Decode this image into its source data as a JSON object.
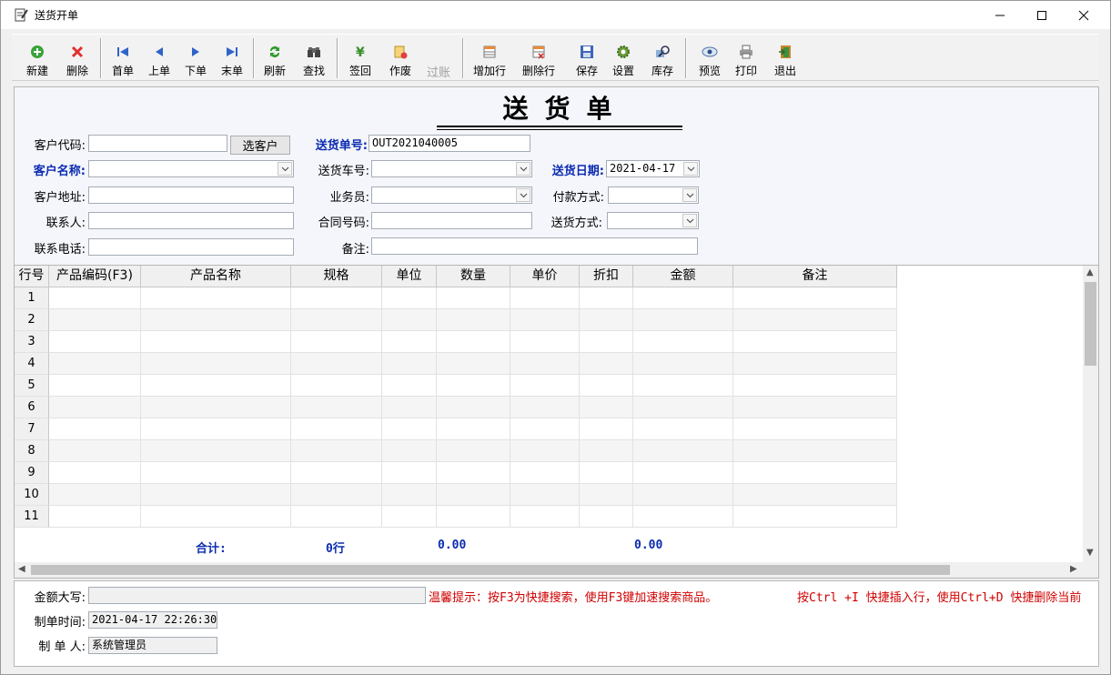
{
  "window": {
    "title": "送货开单"
  },
  "toolbar": {
    "new": "新建",
    "delete": "删除",
    "first": "首单",
    "prev": "上单",
    "next": "下单",
    "last": "末单",
    "refresh": "刷新",
    "find": "查找",
    "sign_back": "签回",
    "void": "作废",
    "post": "过账",
    "add_row": "增加行",
    "delete_row": "删除行",
    "save": "保存",
    "settings": "设置",
    "stock": "库存",
    "preview": "预览",
    "print": "打印",
    "exit": "退出"
  },
  "form": {
    "doc_title": "送货单",
    "customer_code_label": "客户代码:",
    "customer_code_value": "",
    "pick_customer_button": "选客户",
    "order_no_label": "送货单号:",
    "order_no_value": "OUT2021040005",
    "customer_name_label": "客户名称:",
    "customer_name_value": "",
    "vehicle_no_label": "送货车号:",
    "vehicle_no_value": "",
    "delivery_date_label": "送货日期:",
    "delivery_date_value": "2021-04-17",
    "address_label": "客户地址:",
    "address_value": "",
    "salesman_label": "业务员:",
    "salesman_value": "",
    "payment_label": "付款方式:",
    "payment_value": "",
    "contact_label": "联系人:",
    "contact_value": "",
    "contract_label": "合同号码:",
    "contract_value": "",
    "delivery_method_label": "送货方式:",
    "delivery_method_value": "",
    "phone_label": "联系电话:",
    "phone_value": "",
    "remark_label": "备注:",
    "remark_value": ""
  },
  "grid": {
    "columns": [
      "行号",
      "产品编码(F3)",
      "产品名称",
      "规格",
      "单位",
      "数量",
      "单价",
      "折扣",
      "金额",
      "备注"
    ],
    "rows": [
      "1",
      "2",
      "3",
      "4",
      "5",
      "6",
      "7",
      "8",
      "9",
      "10",
      "11"
    ],
    "totals": {
      "label": "合计:",
      "rows": "0行",
      "quantity": "0.00",
      "amount": "0.00"
    }
  },
  "footer": {
    "amount_words_label": "金额大写:",
    "amount_words_value": "",
    "tip1": "温馨提示：按F3为快捷搜索，使用F3键加速搜索商品。",
    "tip2": "按Ctrl +I 快捷插入行，使用Ctrl+D 快捷删除当前",
    "created_time_label": "制单时间:",
    "created_time_value": "2021-04-17 22:26:30",
    "creator_label": "制 单 人:",
    "creator_value": "系统管理员"
  },
  "colors": {
    "required_label": "#0b2bb0",
    "tip": "#d00000",
    "totals": "#0b2bb0"
  }
}
